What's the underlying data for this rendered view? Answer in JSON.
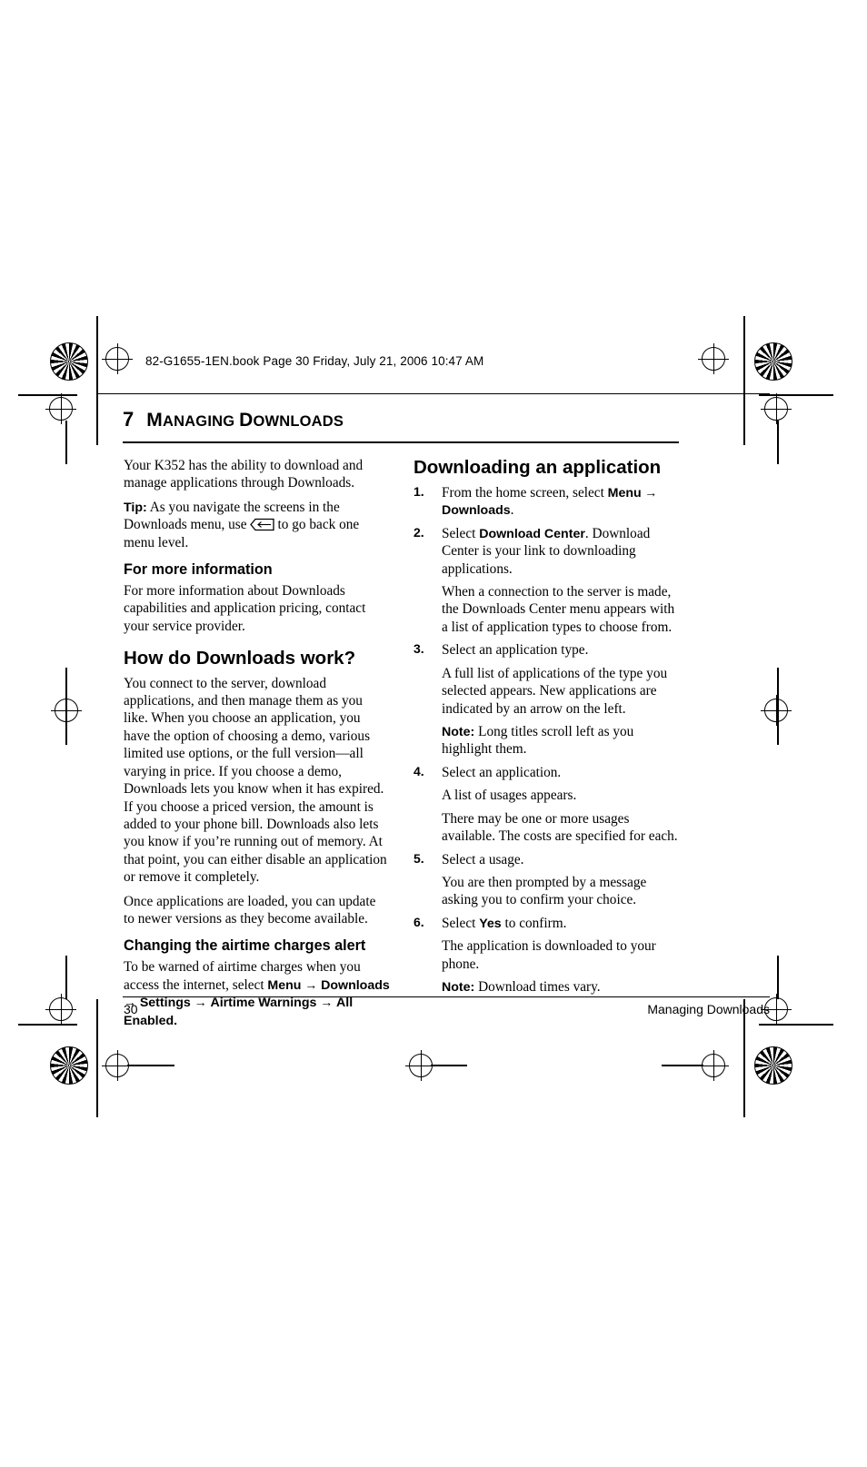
{
  "filestamp": "82-G1655-1EN.book  Page 30  Friday, July 21, 2006  10:47 AM",
  "chapter": {
    "number": "7",
    "title_first": "M",
    "title_rest": "ANAGING ",
    "title_second": "D",
    "title_rest2": "OWNLOADS"
  },
  "left_column": {
    "intro": "Your K352 has the ability to download and manage applications through Downloads.",
    "tip_label": "Tip:",
    "tip_text_before": "As you navigate the screens in the Downloads menu, use",
    "tip_text_after": "to go back one menu level.",
    "more_info_heading": "For more information",
    "more_info_text": "For more information about Downloads capabilities and application pricing, contact your service provider.",
    "how_heading": "How do Downloads work?",
    "how_p1": "You connect to the server, download applications, and then manage them as you like. When you choose an application, you have the option of choosing a demo, various limited use options, or the full version—all varying in price. If you choose a demo, Downloads lets you know when it has expired. If you choose a priced version, the amount is added to your phone bill. Downloads also lets you know if you’re running out of memory. At that point, you can either disable an application or remove it completely.",
    "how_p2": "Once applications are loaded, you can update to newer versions as they become available.",
    "airtime_heading": "Changing the airtime charges alert",
    "airtime_text_plain": "To be warned of airtime charges when you access the internet, select",
    "airtime_menu": "Menu",
    "airtime_downloads": "Downloads",
    "airtime_settings": "Settings",
    "airtime_warnings": "Airtime Warnings",
    "airtime_all_enabled": "All Enabled.",
    "arrow": "→"
  },
  "right_column": {
    "heading": "Downloading an application",
    "steps": [
      {
        "n": "1.",
        "parts": [
          {
            "type": "mixed",
            "pre": "From the home screen, select ",
            "bold1": "Menu",
            "arrow": " → ",
            "bold2": "Downloads",
            "post": "."
          }
        ]
      },
      {
        "n": "2.",
        "parts": [
          {
            "type": "mixed2",
            "pre": "Select ",
            "bold1": "Download Center",
            "post": ". Download Center is your link to downloading applications."
          },
          {
            "type": "plain",
            "text": "When a connection to the server is made, the Downloads Center menu appears with a list of application types to choose from."
          }
        ]
      },
      {
        "n": "3.",
        "parts": [
          {
            "type": "plain",
            "text": "Select an application type."
          },
          {
            "type": "plain",
            "text": "A full list of applications of the type you selected appears. New applications are indicated by an arrow on the left."
          },
          {
            "type": "note",
            "label": "Note:",
            "text": "Long titles scroll left as you highlight them."
          }
        ]
      },
      {
        "n": "4.",
        "parts": [
          {
            "type": "plain",
            "text": "Select an application."
          },
          {
            "type": "plain",
            "text": "A list of usages appears."
          },
          {
            "type": "plain",
            "text": "There may be one or more usages available. The costs are specified for each."
          }
        ]
      },
      {
        "n": "5.",
        "parts": [
          {
            "type": "plain",
            "text": "Select a usage."
          },
          {
            "type": "plain",
            "text": "You are then prompted by a message asking you to confirm your choice."
          }
        ]
      },
      {
        "n": "6.",
        "parts": [
          {
            "type": "mixed2",
            "pre": "Select ",
            "bold1": "Yes",
            "post": " to confirm."
          },
          {
            "type": "plain",
            "text": "The application is downloaded to your phone."
          },
          {
            "type": "note",
            "label": "Note:",
            "text": "Download times vary."
          }
        ]
      }
    ]
  },
  "footer": {
    "page_number": "30",
    "section": "Managing Downloads"
  }
}
